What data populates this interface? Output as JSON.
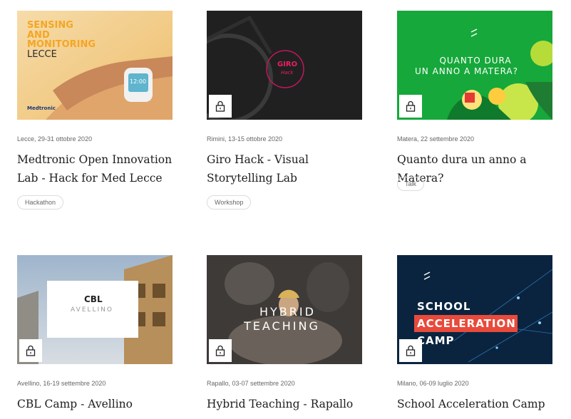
{
  "cards": [
    {
      "meta": "Lecce, 29-31 ottobre 2020",
      "title": "Medtronic Open Innovation Lab - Hack for Med Lecce",
      "tag": "Hackathon",
      "image_text": {
        "line1": "SENSING",
        "line2": "AND",
        "line3": "MONITORING",
        "line4": "LECCE",
        "brand": "Medtronic",
        "watch": "12:00"
      },
      "locked": false
    },
    {
      "meta": "Rimini, 13-15 ottobre 2020",
      "title": "Giro Hack - Visual Storytelling Lab",
      "tag": "Workshop",
      "image_text": {
        "logo": "GIRO",
        "sub": "Hack"
      },
      "locked": true
    },
    {
      "meta": "Matera, 22 settembre 2020",
      "title": "Quanto dura un anno a Matera?",
      "tag": "Talk",
      "image_text": {
        "line1": "QUANTO DURA",
        "line2": "UN ANNO A MATERA?"
      },
      "locked": true
    },
    {
      "meta": "Avellino, 16-19 settembre 2020",
      "title": "CBL Camp - Avellino",
      "image_text": {
        "logo": "CBL",
        "city": "AVELLINO"
      },
      "locked": true
    },
    {
      "meta": "Rapallo, 03-07 settembre 2020",
      "title": "Hybrid Teaching - Rapallo",
      "image_text": {
        "line1": "HYBRID",
        "line2": "TEACHING"
      },
      "locked": true
    },
    {
      "meta": "Milano, 06-09 luglio 2020",
      "title": "School Acceleration Camp",
      "image_text": {
        "line1": "SCHOOL",
        "line2": "ACCELERATION",
        "line3": "CAMP"
      },
      "locked": true
    }
  ],
  "colors": {
    "accent_orange": "#f4a624",
    "green": "#14a73a",
    "red_banner": "#e84a3b",
    "navy": "#0b2540",
    "lock_icon": "lock-icon"
  }
}
